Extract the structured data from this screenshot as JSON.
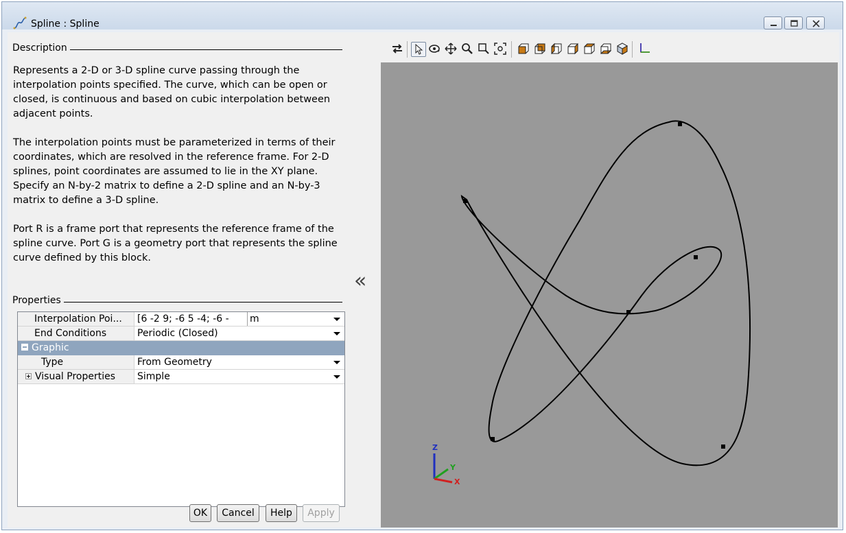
{
  "window": {
    "title": "Spline : Spline"
  },
  "description": {
    "label": "Description",
    "paragraphs": [
      "Represents a 2-D or 3-D spline curve passing through the interpolation points specified. The curve, which can be open or closed, is continuous and based on cubic interpolation between adjacent points.",
      "The interpolation points must be parameterized in terms of their coordinates, which are resolved in the reference frame. For 2-D splines, point coordinates are assumed to lie in the XY plane. Specify an N-by-2 matrix to define a 2-D spline and an N-by-3 matrix to define a 3-D spline.",
      "Port R is a frame port that represents the reference frame of the spline curve. Port G is a geometry port that represents the spline curve defined by this block."
    ]
  },
  "properties": {
    "label": "Properties",
    "interpolation_points": {
      "name": "Interpolation Poi...",
      "value": "[6 -2 9; -6 5 -4; -6 -",
      "unit": "m"
    },
    "end_conditions": {
      "name": "End Conditions",
      "value": "Periodic (Closed)"
    },
    "graphic_group": {
      "name": "Graphic",
      "expander": "−"
    },
    "type": {
      "name": "Type",
      "value": "From Geometry"
    },
    "visual_properties": {
      "name": "Visual Properties",
      "value": "Simple",
      "expander": "+"
    }
  },
  "buttons": {
    "ok": "OK",
    "cancel": "Cancel",
    "help": "Help",
    "apply": "Apply"
  },
  "viewer": {
    "collapse_glyph": "«",
    "background": "#999999",
    "axes": {
      "z": "Z",
      "y": "Y",
      "x": "X"
    },
    "toolbar_icons": [
      "swap-icon",
      "select-icon",
      "rotate-icon",
      "pan-icon",
      "zoom-icon",
      "zoom-box-icon",
      "fit-to-view-icon",
      "front-view-icon",
      "back-view-icon",
      "left-view-icon",
      "right-view-icon",
      "top-view-icon",
      "bottom-view-icon",
      "isometric-view-icon",
      "frame-axes-icon"
    ]
  },
  "colors": {
    "accent": "#8fa5be",
    "axis_x": "#d02020",
    "axis_y": "#20a020",
    "axis_z": "#2030c0"
  }
}
